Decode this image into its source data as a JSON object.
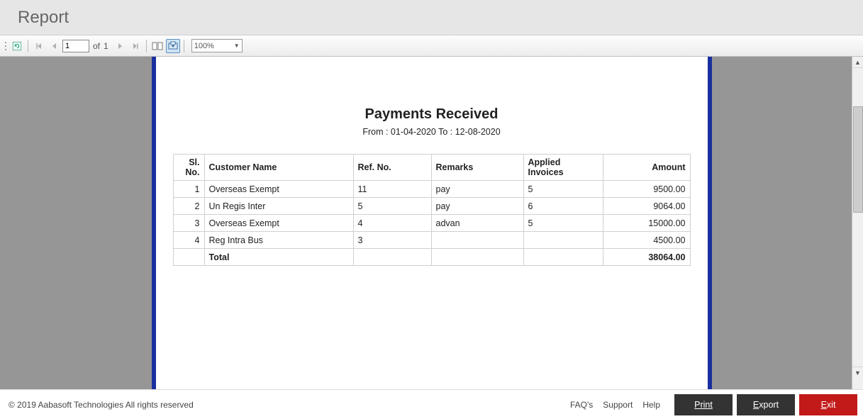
{
  "header": {
    "title": "Report"
  },
  "toolbar": {
    "current_page": "1",
    "of_label": "of",
    "total_pages": "1",
    "zoom": "100%"
  },
  "report": {
    "title": "Payments Received",
    "subtitle": "From : 01-04-2020 To : 12-08-2020",
    "headers": {
      "slno": "Sl. No.",
      "customer": "Customer Name",
      "refno": "Ref. No.",
      "remarks": "Remarks",
      "applied": "Applied Invoices",
      "amount": "Amount"
    },
    "rows": [
      {
        "slno": "1",
        "customer": "Overseas Exempt",
        "refno": "11",
        "remarks": "pay",
        "applied": "5",
        "amount": "9500.00"
      },
      {
        "slno": "2",
        "customer": "Un Regis Inter",
        "refno": "5",
        "remarks": "pay",
        "applied": "6",
        "amount": "9064.00"
      },
      {
        "slno": "3",
        "customer": "Overseas Exempt",
        "refno": "4",
        "remarks": "advan",
        "applied": "5",
        "amount": "15000.00"
      },
      {
        "slno": "4",
        "customer": "Reg Intra Bus",
        "refno": "3",
        "remarks": "",
        "applied": "",
        "amount": "4500.00"
      }
    ],
    "total_label": "Total",
    "total_amount": "38064.00"
  },
  "footer": {
    "copyright": "© 2019 Aabasoft Technologies All rights reserved",
    "links": {
      "faqs": "FAQ's",
      "support": "Support",
      "help": "Help"
    },
    "buttons": {
      "print": "Print",
      "export": "Export",
      "exit": "Exit"
    }
  }
}
